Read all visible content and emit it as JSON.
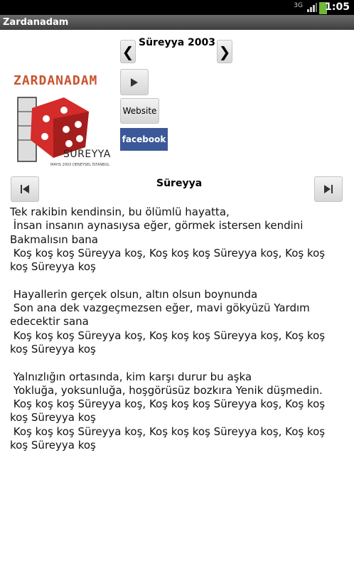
{
  "status_bar": {
    "network": "3G",
    "time": "1:05"
  },
  "app": {
    "title": "Zardanadam"
  },
  "album": {
    "title": "Süreyya 2003"
  },
  "buttons": {
    "website": "Website",
    "facebook": "facebook"
  },
  "logo": {
    "brand": "ZARDANADAM",
    "name": "SUREYYA",
    "caption": "MAYIS 2003 DENEYSEL İSTANBUL"
  },
  "song": {
    "title": "Süreyya"
  },
  "lyrics": "Tek rakibin kendinsin, bu ölümlü hayatta,\n İnsan insanın aynasıysa eğer, görmek istersen kendini Bakmalısın bana\n Koş koş koş Süreyya koş, Koş koş koş Süreyya koş, Koş koş koş Süreyya koş\n\n Hayallerin gerçek olsun, altın olsun boynunda\n Son ana dek vazgeçmezsen eğer, mavi gökyüzü Yardım edecektir sana\n Koş koş koş Süreyya koş, Koş koş koş Süreyya koş, Koş koş koş Süreyya koş\n\n Yalnızlığın ortasında, kim karşı durur bu aşka\n Yokluğa, yoksunluğa, hoşgörüsüz bozkıra Yenik düşmedin.\n Koş koş koş Süreyya koş, Koş koş koş Süreyya koş, Koş koş koş Süreyya koş\n Koş koş koş Süreyya koş, Koş koş koş Süreyya koş, Koş koş koş Süreyya koş",
  "icons": {
    "prev_album": "chevron-left-icon",
    "next_album": "chevron-right-icon",
    "play": "play-icon",
    "prev_song": "skip-previous-icon",
    "next_song": "skip-next-icon"
  },
  "colors": {
    "facebook": "#3b5998",
    "logo_brand": "#c8532e",
    "dice": "#d42b2b"
  }
}
